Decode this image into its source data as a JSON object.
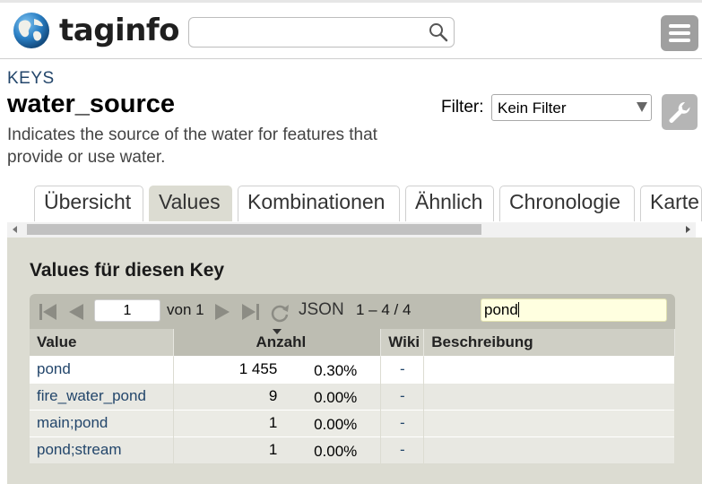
{
  "header": {
    "logo_text": "taginfo",
    "search_placeholder": "",
    "icons": {
      "logo": "globe-icon",
      "search": "magnifier-icon",
      "menu": "hamburger-menu-icon"
    }
  },
  "key": {
    "breadcrumb": "KEYS",
    "name": "water_source",
    "description": "Indicates the source of the water for features that provide or use water."
  },
  "filter": {
    "label": "Filter:",
    "selected": "Kein Filter",
    "tools_icon": "wrench-icon"
  },
  "tabs": [
    {
      "label": "Übersicht",
      "active": false
    },
    {
      "label": "Values",
      "active": true
    },
    {
      "label": "Kombinationen",
      "active": false
    },
    {
      "label": "Ähnlich",
      "active": false
    },
    {
      "label": "Chronologie",
      "active": false
    },
    {
      "label": "Karte",
      "active": false
    }
  ],
  "panel": {
    "title": "Values für diesen Key",
    "pager": {
      "page": "1",
      "of_label": "von 1",
      "json_label": "JSON",
      "range": "1 – 4 / 4",
      "quick_search": "pond"
    },
    "columns": [
      "Value",
      "Anzahl",
      "Wiki",
      "Beschreibung"
    ],
    "rows": [
      {
        "value": "pond",
        "count": "1 455",
        "percent": "0.30%",
        "wiki": "-",
        "desc": ""
      },
      {
        "value": "fire_water_pond",
        "count": "9",
        "percent": "0.00%",
        "wiki": "-",
        "desc": ""
      },
      {
        "value": "main;pond",
        "count": "1",
        "percent": "0.00%",
        "wiki": "-",
        "desc": ""
      },
      {
        "value": "pond;stream",
        "count": "1",
        "percent": "0.00%",
        "wiki": "-",
        "desc": ""
      }
    ]
  },
  "colors": {
    "accent_link": "#23466b",
    "panel_bg": "#dcdcd2",
    "pager_bg": "#bdbdb2",
    "quick_search_bg": "#ffffe0"
  }
}
